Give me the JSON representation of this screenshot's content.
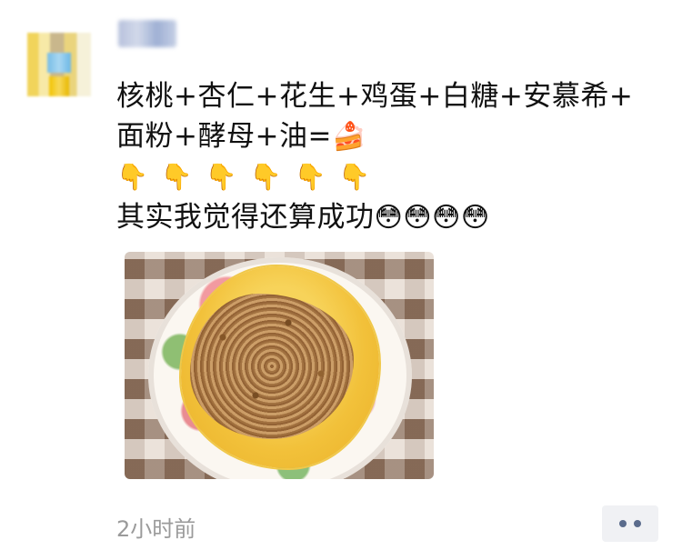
{
  "post": {
    "text_line1": "核桃+杏仁+花生+鸡蛋+白糖+安慕希+",
    "text_line2": "面粉+酵母+油=",
    "cake_emoji": "🍰",
    "hands_emoji": "👇👇👇👇👇👇",
    "text_line4": "其实我觉得还算成功",
    "faces_emoji": "😳😳😳😳",
    "timestamp": "2小时前"
  },
  "icons": {
    "more": "more-dots-icon"
  },
  "colors": {
    "timestamp": "#9a9a9a",
    "more_button_bg": "#f0f1f4",
    "more_dots": "#5a6b8c"
  }
}
